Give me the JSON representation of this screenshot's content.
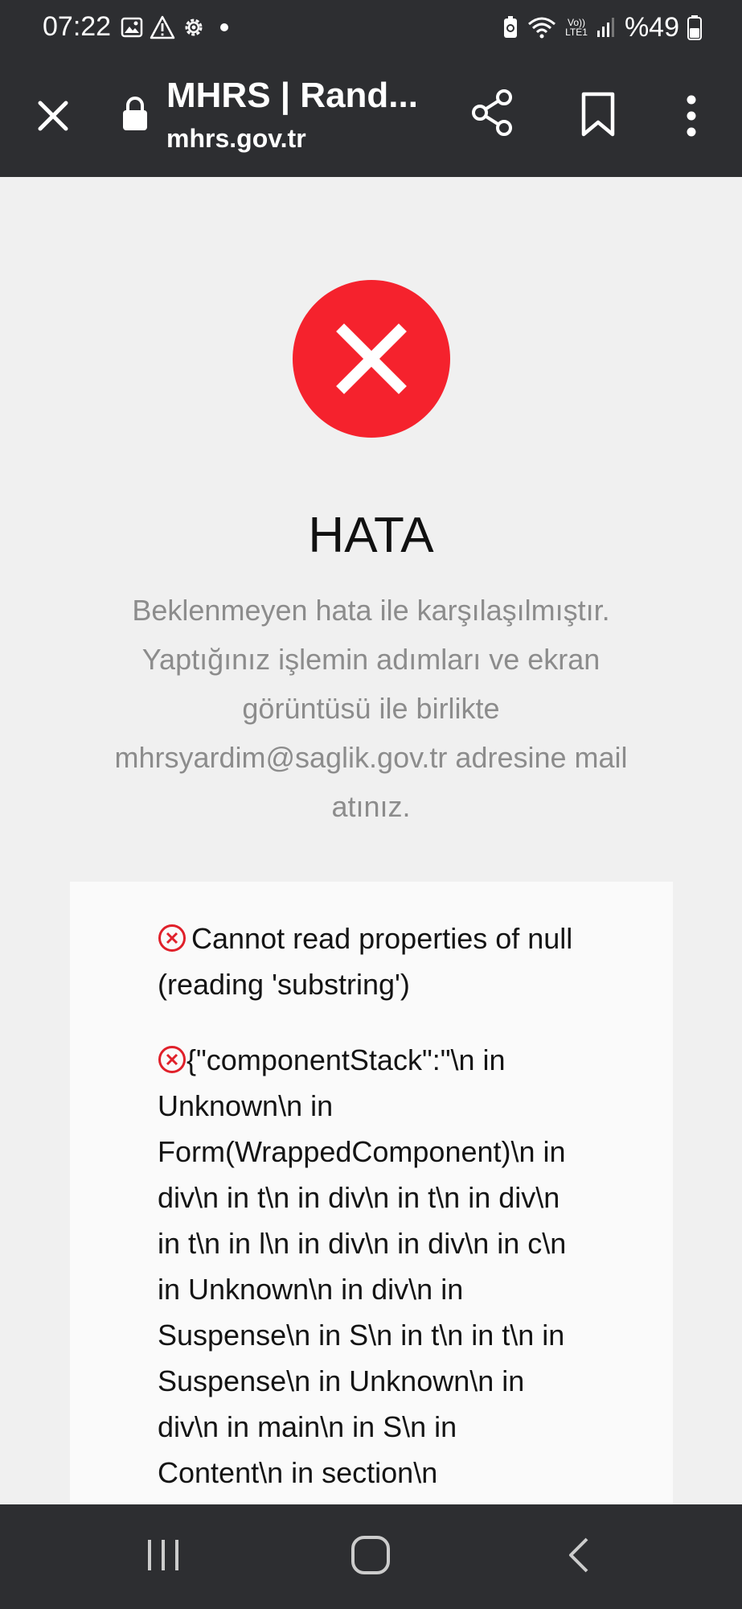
{
  "status_bar": {
    "time": "07:22",
    "left_icons": [
      "image-icon",
      "warning-icon",
      "settings-icon",
      "dot-icon"
    ],
    "lte_label_top": "Vo))",
    "lte_label_bottom": "LTE1",
    "battery": "%49"
  },
  "browser": {
    "title": "MHRS | Rand...",
    "url": "mhrs.gov.tr",
    "icons": [
      "close-icon",
      "lock-icon",
      "share-icon",
      "bookmark-icon",
      "more-icon"
    ]
  },
  "error_page": {
    "heading": "HATA",
    "message": "Beklenmeyen hata ile karşılaşılmıştır. Yaptığınız işlemin adımları ve ekran görüntüsü ile birlikte mhrsyardim@saglik.gov.tr adresine mail atınız.",
    "details": [
      "Cannot read properties of null (reading 'substring')",
      "{\"componentStack\":\"\\n in Unknown\\n in Form(WrappedComponent)\\n in div\\n in t\\n in div\\n in t\\n in div\\n in t\\n in l\\n in div\\n in div\\n in c\\n in Unknown\\n in div\\n in Suspense\\n in S\\n in t\\n in t\\n in Suspense\\n in Unknown\\n in div\\n in main\\n in S\\n in Content\\n in section\\n"
    ]
  },
  "colors": {
    "error_red": "#f5222d",
    "bar_dark": "#2d2e31",
    "message_gray": "#8c8c8c"
  }
}
